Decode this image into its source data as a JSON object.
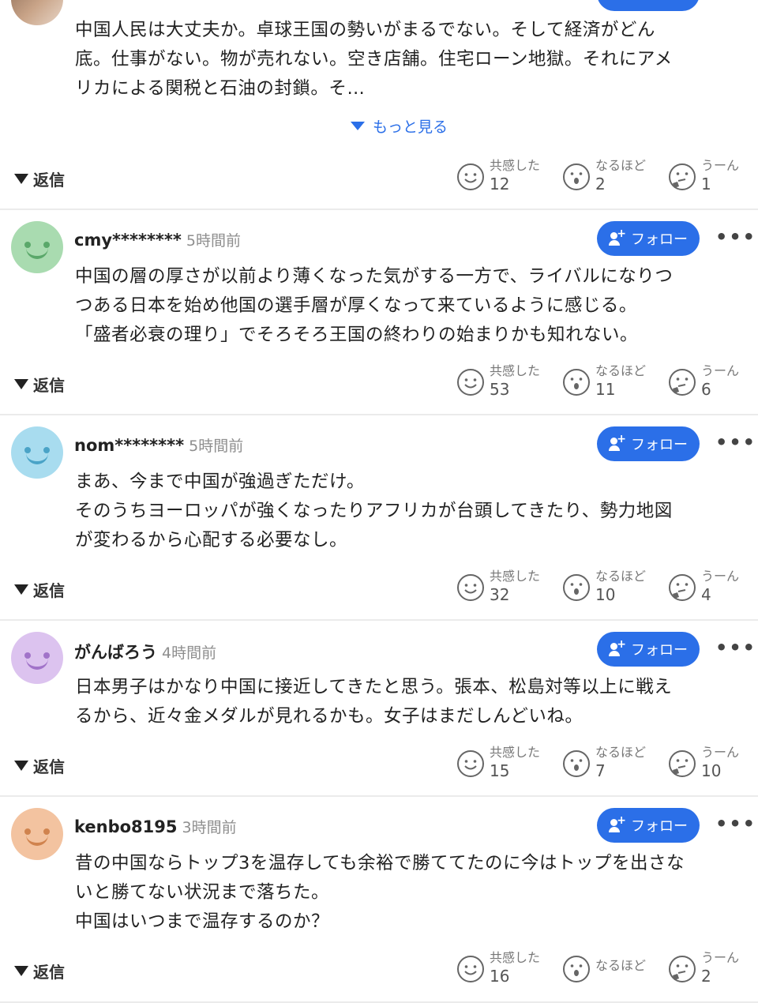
{
  "colors": {
    "accent": "#2b6fe8",
    "divider": "#ebebeb"
  },
  "labels": {
    "reply": "返信",
    "follow": "フォロー",
    "more": "•••",
    "show_more": "もっと見る",
    "react_empathy": "共感した",
    "react_indeed": "なるほど",
    "react_hmm": "うーん"
  },
  "first_comment": {
    "body": "中国人民は大丈夫か。卓球王国の勢いがまるでない。そして経済がどん\n底。仕事がない。物が売れない。空き店舗。住宅ローン地獄。それにアメ\nリカによる関税と石油の封鎖。そ…",
    "reactions": {
      "empathy": "12",
      "indeed": "2",
      "hmm": "1"
    }
  },
  "comments": [
    {
      "user": "cmy********",
      "time": "5時間前",
      "avatar_color": "#a9dbb0",
      "avatar_face": "#5aa86a",
      "body": "中国の層の厚さが以前より薄くなった気がする一方で、ライバルになりつ\nつある日本を始め他国の選手層が厚くなって来ているように感じる。\n「盛者必衰の理り」でそろそろ王国の終わりの始まりかも知れない。",
      "reactions": {
        "empathy": "53",
        "indeed": "11",
        "hmm": "6"
      }
    },
    {
      "user": "nom********",
      "time": "5時間前",
      "avatar_color": "#a8dcef",
      "avatar_face": "#4aa3c7",
      "body": "まあ、今まで中国が強過ぎただけ。\nそのうちヨーロッパが強くなったりアフリカが台頭してきたり、勢力地図\nが変わるから心配する必要なし。",
      "reactions": {
        "empathy": "32",
        "indeed": "10",
        "hmm": "4"
      }
    },
    {
      "user": "がんばろう",
      "time": "4時間前",
      "avatar_color": "#dcc3ef",
      "avatar_face": "#a173c9",
      "body": "日本男子はかなり中国に接近してきたと思う。張本、松島対等以上に戦え\nるから、近々金メダルが見れるかも。女子はまだしんどいね。",
      "reactions": {
        "empathy": "15",
        "indeed": "7",
        "hmm": "10"
      }
    },
    {
      "user": "kenbo8195",
      "time": "3時間前",
      "avatar_color": "#f3c3a0",
      "avatar_face": "#d0834e",
      "body": "昔の中国ならトップ3を温存しても余裕で勝ててたのに今はトップを出さな\nいと勝てない状況まで落ちた。\n中国はいつまで温存するのか？",
      "reactions": {
        "empathy": "16",
        "indeed": "",
        "hmm": "2"
      }
    }
  ]
}
